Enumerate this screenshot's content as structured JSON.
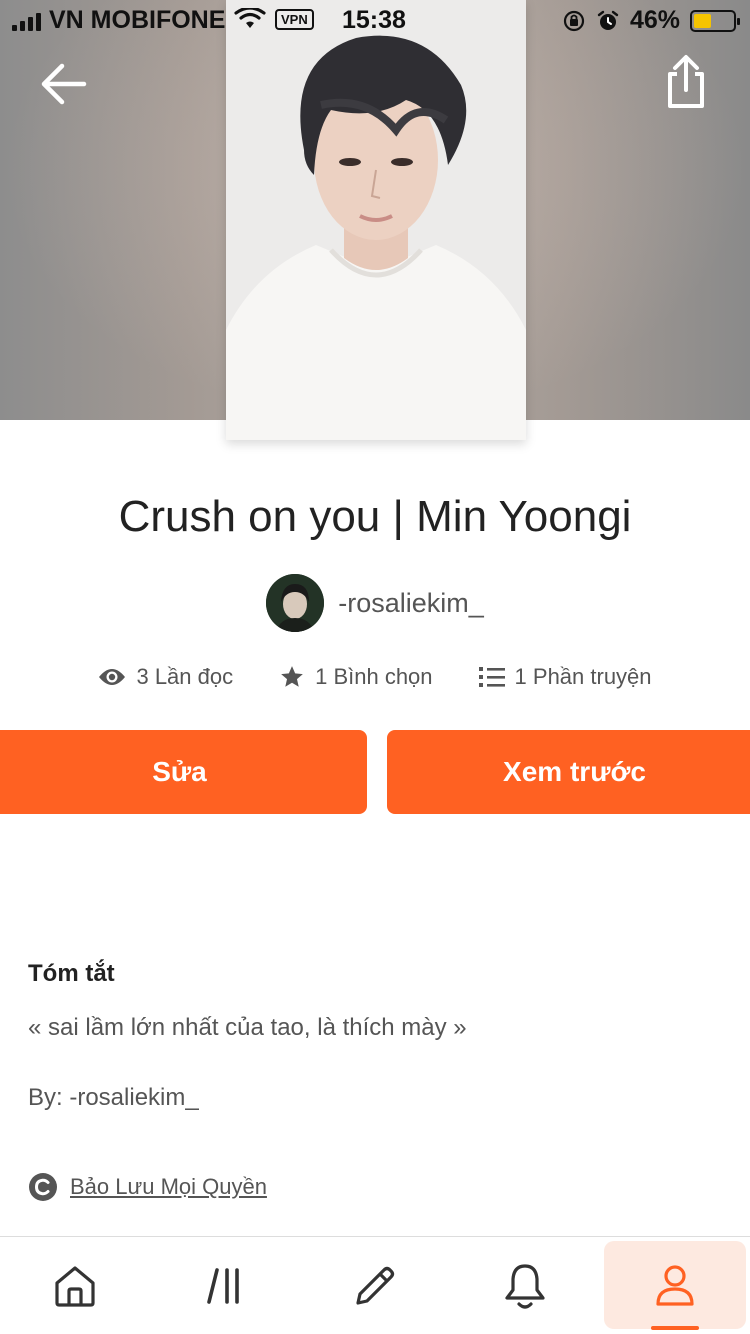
{
  "status_bar": {
    "carrier": "VN MOBIFONE",
    "vpn_label": "VPN",
    "time": "15:38",
    "battery_percent": "46%",
    "battery_level": 0.46,
    "icons": [
      "signal-icon",
      "wifi-icon",
      "orientation-lock-icon",
      "alarm-icon",
      "battery-icon"
    ]
  },
  "header": {
    "back_icon": "arrow-left-icon",
    "share_icon": "share-icon"
  },
  "story": {
    "title": "Crush on you | Min Yoongi",
    "author": "-rosaliekim_",
    "stats": {
      "reads": "3 Lần đọc",
      "votes": "1 Bình chọn",
      "parts": "1 Phần truyện"
    }
  },
  "actions": {
    "edit_label": "Sửa",
    "preview_label": "Xem trước"
  },
  "summary": {
    "heading": "Tóm tắt",
    "text": "« sai lầm lớn nhất của tao, là thích mày »",
    "by_line": "By: -rosaliekim_",
    "copyright": "Bảo Lưu Mọi Quyền"
  },
  "bottom_nav": {
    "items": [
      "home-icon",
      "library-icon",
      "write-icon",
      "notifications-icon",
      "profile-icon"
    ],
    "active": "profile-icon"
  },
  "colors": {
    "accent": "#ff6122",
    "active_nav_bg": "#fde9e0",
    "text_primary": "#222222",
    "text_secondary": "#555555"
  }
}
